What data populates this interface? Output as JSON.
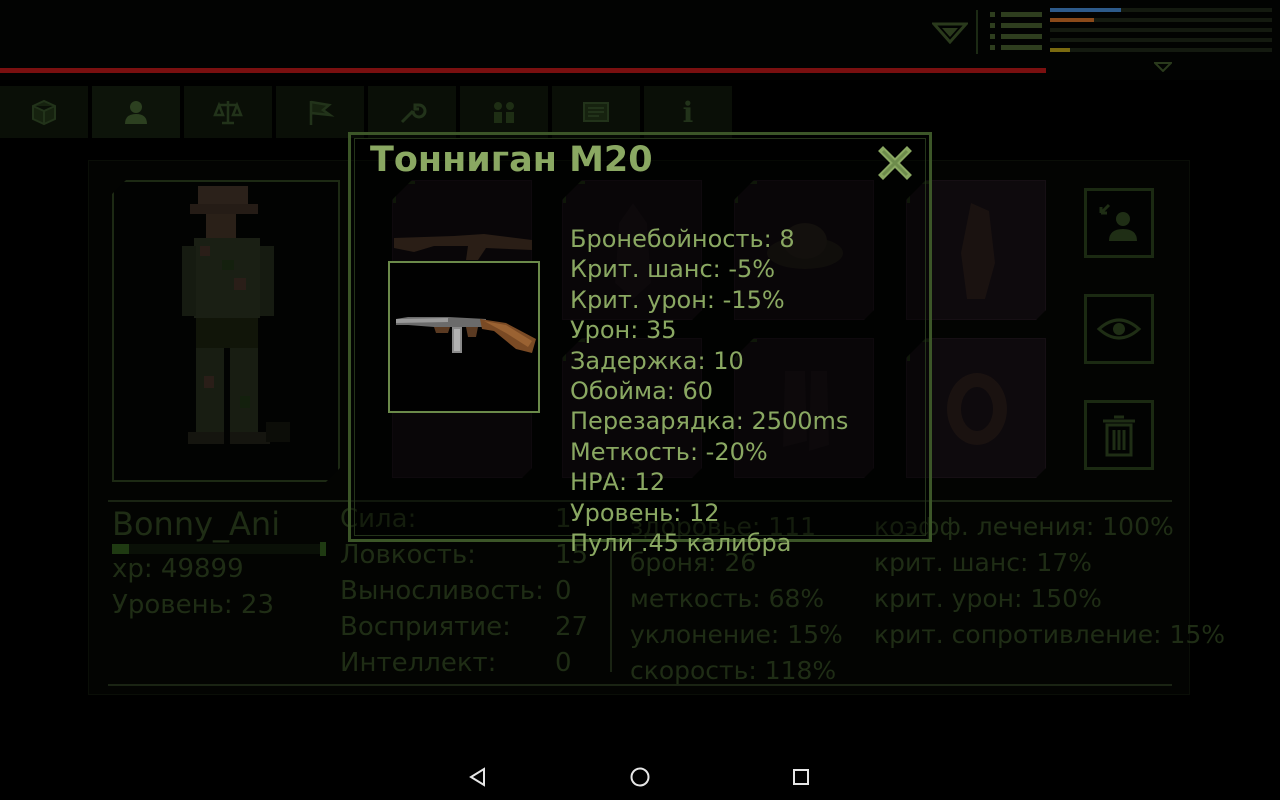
{
  "hud": {
    "menu_rows": 4,
    "stat_bars": [
      {
        "color": "#2d5a8a",
        "fraction": 0.32
      },
      {
        "color": "#8a4a1a",
        "fraction": 0.2
      },
      {
        "color": "#2f3f1f",
        "fraction": 0.0
      },
      {
        "color": "#2f3f1f",
        "fraction": 0.0
      },
      {
        "color": "#7a6a10",
        "fraction": 0.09
      }
    ],
    "hp_color": "#7a1010"
  },
  "tabs": [
    {
      "icon": "box-icon"
    },
    {
      "icon": "person-icon"
    },
    {
      "icon": "scales-icon"
    },
    {
      "icon": "flag-icon"
    },
    {
      "icon": "wrench-icon"
    },
    {
      "icon": "group-icon"
    },
    {
      "icon": "notes-icon"
    },
    {
      "icon": "info-icon",
      "glyph": "i"
    }
  ],
  "character": {
    "name": "Bonny_Ani",
    "xp": "xp: 49899",
    "level": "Уровень: 23",
    "xp_fraction": 0.08,
    "attributes": [
      {
        "label": "Сила:",
        "value": "1"
      },
      {
        "label": "Ловкость:",
        "value": "15"
      },
      {
        "label": "Выносливость:",
        "value": "0"
      },
      {
        "label": "Восприятие:",
        "value": "27"
      },
      {
        "label": "Интеллект:",
        "value": "0"
      }
    ],
    "combat_stats": [
      "здоровье: 111",
      "броня: 26",
      "меткость: 68%",
      "уклонение: 15%",
      "скорость: 118%"
    ],
    "extra_stats": [
      "коэфф. лечения: 100%",
      "крит. шанс: 17%",
      "крит. урон: 150%",
      "крит. сопротивление: 15%"
    ]
  },
  "side_buttons": [
    "transfer-person-icon",
    "eye-icon",
    "trash-icon"
  ],
  "popup": {
    "title": "Тонниган M20",
    "close_glyph": "✖",
    "stats": [
      "Бронебойность: 8",
      "Крит. шанс: -5%",
      "Крит. урон: -15%",
      "Урон: 35",
      "Задержка: 10",
      "Обойма: 60",
      "Перезарядка: 2500ms",
      "Меткость: -20%",
      "НРА: 12",
      "Уровень: 12",
      "Пули .45 калибра"
    ]
  },
  "navbar": [
    "back-icon",
    "home-icon",
    "recents-icon"
  ],
  "colors": {
    "accent": "#8aa862",
    "border": "#3c5628",
    "dim_text": "#1f2d15",
    "background": "#000000"
  }
}
